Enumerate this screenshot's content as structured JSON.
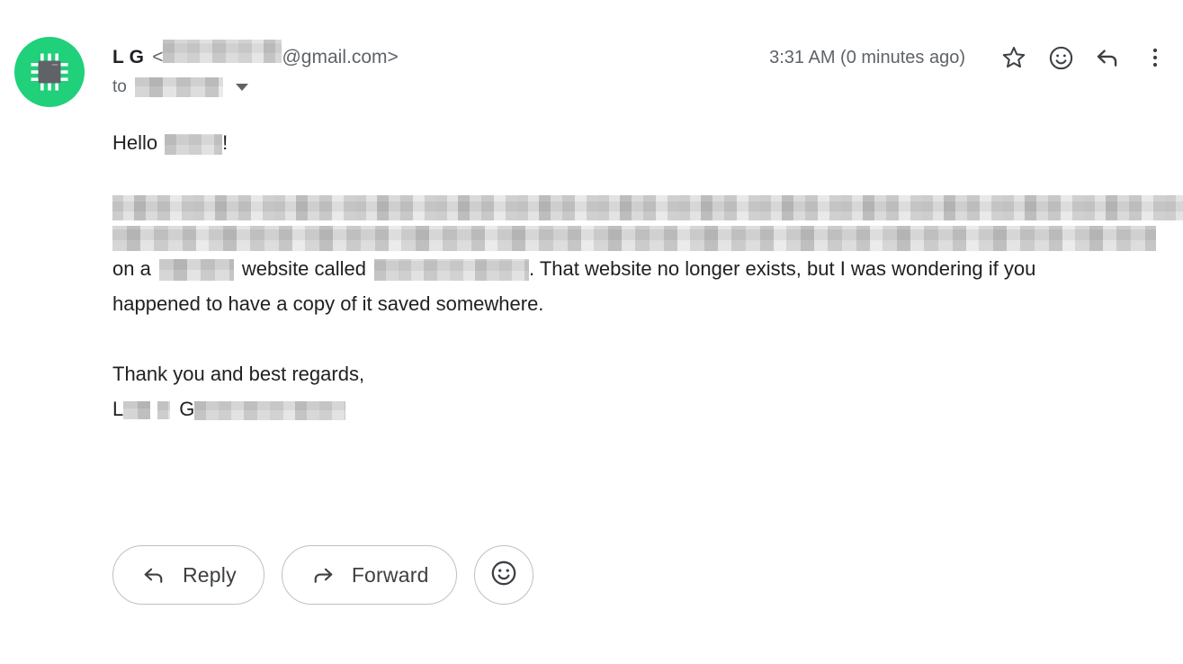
{
  "message": {
    "sender": {
      "name": "L G",
      "email_prefix_redacted": true,
      "email_domain": "@gmail.com",
      "email_open_bracket": "<",
      "email_close_bracket": ">",
      "avatar_icon": "microchip-icon",
      "avatar_color": "#21d07a",
      "avatar_glyph_color": "#5f6368"
    },
    "recipient": {
      "to_label": "to",
      "recipient_redacted": true,
      "expand_icon": "chevron-down-icon"
    },
    "timestamp": "3:31 AM (0 minutes ago)",
    "header_actions": [
      {
        "name": "star-icon",
        "label": "Star"
      },
      {
        "name": "emoji-icon",
        "label": "Add reaction"
      },
      {
        "name": "reply-icon",
        "label": "Reply"
      },
      {
        "name": "more-vert-icon",
        "label": "More"
      }
    ],
    "body": {
      "greeting_prefix": "Hello",
      "greeting_suffix": "!",
      "greeting_name_redacted": true,
      "redacted_lines": 2,
      "line_on_a_prefix": "on a",
      "line_website_called": "website called",
      "line_after_site": ". That website no longer exists, but I was wondering if you",
      "line_final": "happened to have a copy of it saved somewhere.",
      "closing": "Thank you and best regards,",
      "signature_initial_first": "L",
      "signature_initial_last": "G"
    },
    "footer_actions": {
      "reply_label": "Reply",
      "reply_icon": "reply-arrow-icon",
      "forward_label": "Forward",
      "forward_icon": "forward-arrow-icon",
      "emoji_icon": "emoji-smiley-icon"
    }
  },
  "colors": {
    "accent_green": "#21d07a",
    "text_primary": "#202124",
    "text_secondary": "#5f6368",
    "border": "#bdc1c6",
    "background": "#ffffff"
  }
}
